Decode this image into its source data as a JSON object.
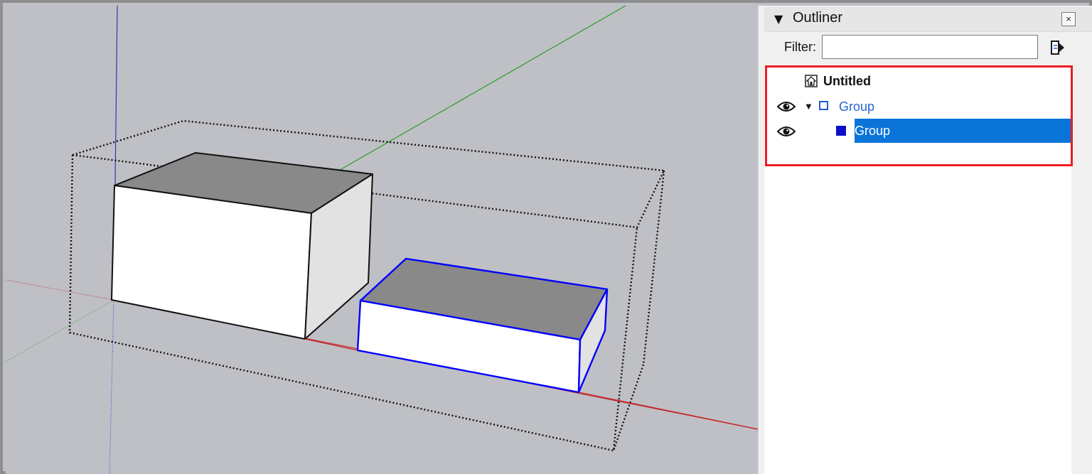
{
  "outliner": {
    "title": "Outliner",
    "collapse_icon": "triangle-down-icon",
    "close_label": "×",
    "filter_label": "Filter:",
    "filter_value": "",
    "details_icon": "details-arrow-icon",
    "tree": [
      {
        "label": "Untitled",
        "icon": "model-house-icon",
        "level": 0,
        "selected": false
      },
      {
        "label": "Group",
        "icon": "group-outline-icon",
        "level": 1,
        "expanded": true,
        "visible": true,
        "selected": false
      },
      {
        "label": "Group",
        "icon": "group-filled-icon",
        "level": 2,
        "visible": true,
        "selected": true
      }
    ]
  },
  "colors": {
    "viewport_bg": "#bfc0c5",
    "x_axis": "#c4282c",
    "y_axis": "#2a9d2a",
    "z_axis": "#3232c8",
    "selection": "#0000ff",
    "selected_row": "#0a74d8",
    "annotation_box": "#ee1c24",
    "link_text": "#2264d6"
  }
}
